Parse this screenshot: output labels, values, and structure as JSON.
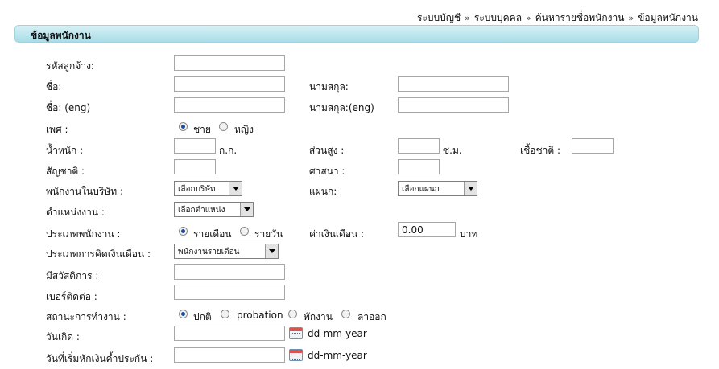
{
  "breadcrumb": {
    "items": [
      "ระบบบัญชี",
      "ระบบบุคคล",
      "ค้นหารายชื่อพนักงาน",
      "ข้อมูลพนักงาน"
    ],
    "separator": "»"
  },
  "section": {
    "title": "ข้อมูลพนักงาน"
  },
  "form": {
    "employee_code": {
      "label": "รหัสลูกจ้าง:",
      "value": ""
    },
    "first_name": {
      "label": "ชื่อ:",
      "value": ""
    },
    "last_name": {
      "label": "นามสกุล:",
      "value": ""
    },
    "first_name_eng": {
      "label": "ชื่อ: (eng)",
      "value": ""
    },
    "last_name_eng": {
      "label": "นามสกุล:(eng)",
      "value": ""
    },
    "gender": {
      "label": "เพศ :",
      "options": [
        "ชาย",
        "หญิง"
      ],
      "selected": "ชาย"
    },
    "weight": {
      "label": "น้ำหนัก :",
      "unit": "ก.ก.",
      "value": ""
    },
    "height": {
      "label": "ส่วนสูง :",
      "unit": "ซ.ม.",
      "value": ""
    },
    "ethnicity": {
      "label": "เชื้อชาติ :",
      "value": ""
    },
    "nationality": {
      "label": "สัญชาติ :",
      "value": ""
    },
    "religion": {
      "label": "ศาสนา :",
      "value": ""
    },
    "company": {
      "label": "พนักงานในบริษัท :",
      "selected": "เลือกบริษัท"
    },
    "department": {
      "label": "แผนก:",
      "selected": "เลือกแผนก"
    },
    "position": {
      "label": "ตำแหน่งงาน :",
      "selected": "เลือกตำแหน่ง"
    },
    "employee_type": {
      "label": "ประเภทพนักงาน :",
      "options": [
        "รายเดือน",
        "รายวัน"
      ],
      "selected": "รายเดือน"
    },
    "salary": {
      "label": "ค่าเงินเดือน :",
      "value": "0.00",
      "unit": "บาท"
    },
    "salary_calc": {
      "label": "ประเภทการคิดเงินเดือน :",
      "selected": "พนักงานรายเดือน"
    },
    "welfare": {
      "label": "มีสวัสดิการ :",
      "value": ""
    },
    "phone": {
      "label": "เบอร์ติดต่อ :",
      "value": ""
    },
    "work_status": {
      "label": "สถานะการทำงาน :",
      "options": [
        "ปกติ",
        "probation",
        "พักงาน",
        "ลาออก"
      ],
      "selected": "ปกติ"
    },
    "birth_date": {
      "label": "วันเกิด :",
      "value": "",
      "format_hint": "dd-mm-year"
    },
    "guarantee_start": {
      "label": "วันที่เริ่มหักเงินค้ำประกัน :",
      "value": "",
      "format_hint": "dd-mm-year"
    }
  },
  "icons": {
    "calendar": "calendar-icon",
    "dropdown": "chevron-down-icon"
  },
  "colors": {
    "header_start": "#d6f1f6",
    "header_end": "#a9dde7",
    "radio_on": "#1b4ba0"
  }
}
